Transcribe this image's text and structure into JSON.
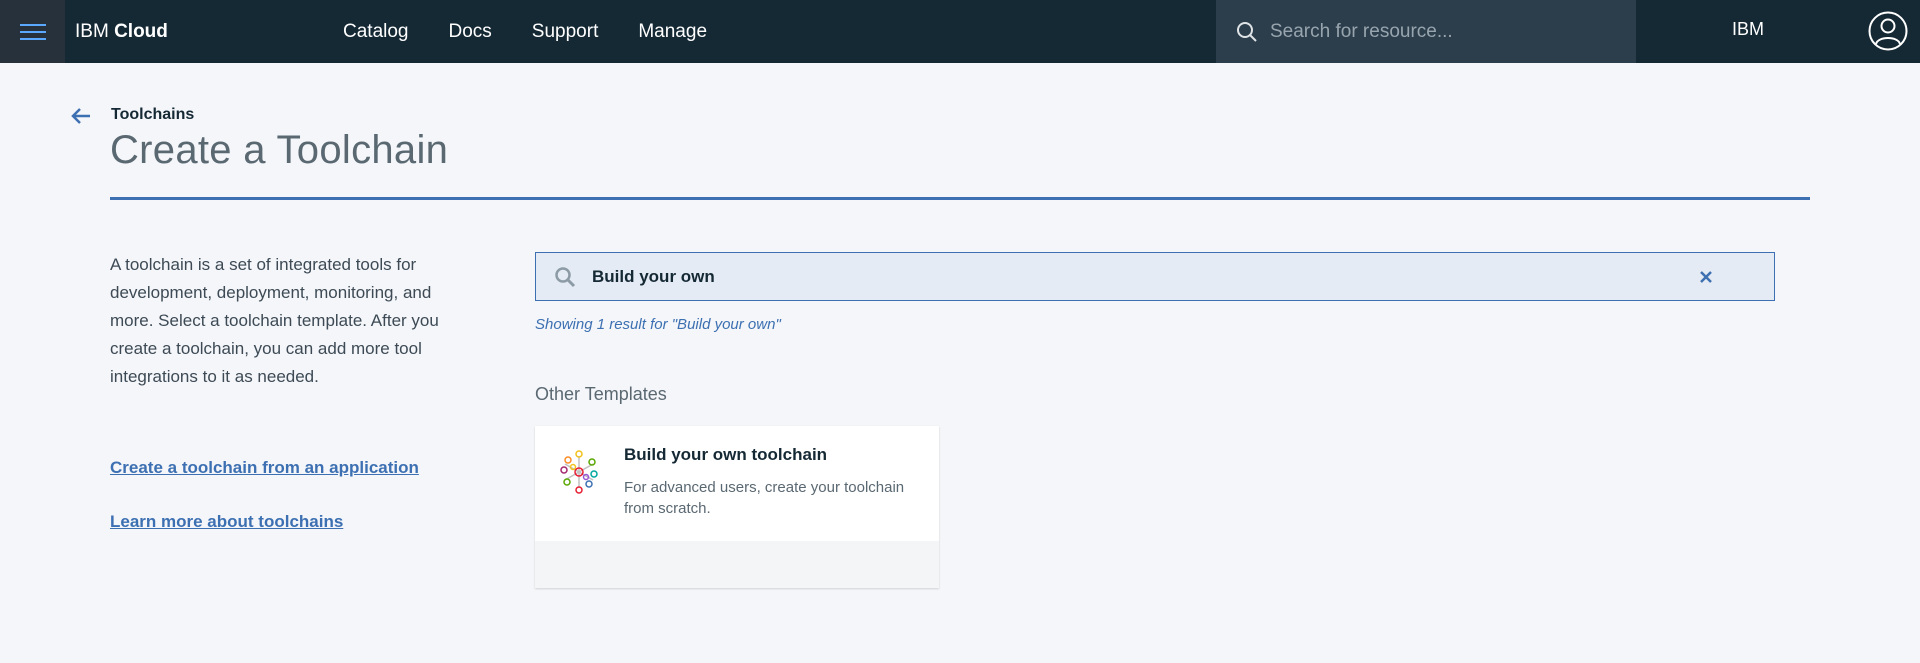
{
  "topbar": {
    "brand_prefix": "IBM",
    "brand_suffix": "Cloud",
    "nav": [
      "Catalog",
      "Docs",
      "Support",
      "Manage"
    ],
    "search_placeholder": "Search for resource...",
    "account": "IBM"
  },
  "header": {
    "breadcrumb": "Toolchains",
    "title": "Create a Toolchain"
  },
  "sidebar": {
    "intro": "A toolchain is a set of integrated tools for development, deployment, monitoring, and more. Select a toolchain template. After you create a toolchain, you can add more tool integrations to it as needed.",
    "links": [
      "Create a toolchain from an application",
      "Learn more about toolchains"
    ]
  },
  "search": {
    "value": "Build your own",
    "result_text": "Showing 1 result for \"Build your own\""
  },
  "templates": {
    "heading": "Other Templates",
    "cards": [
      {
        "title": "Build your own toolchain",
        "description": "For advanced users, create your toolchain from scratch.",
        "icon": "toolchain-hub-icon"
      }
    ]
  },
  "colors": {
    "topbar_bg": "#152935",
    "accent": "#3d70b2",
    "page_bg": "#f4f6f9"
  }
}
